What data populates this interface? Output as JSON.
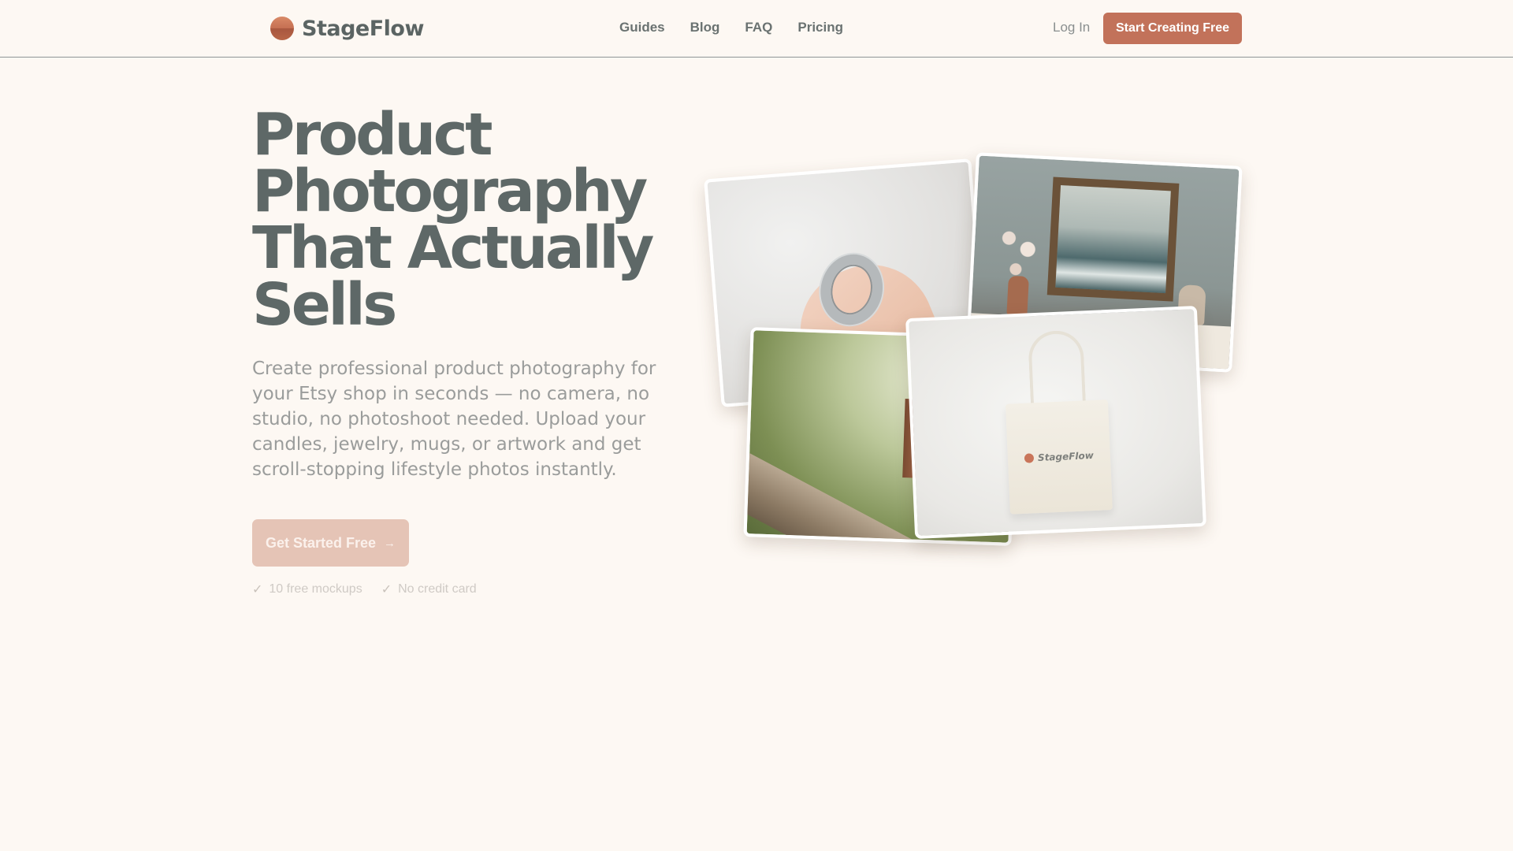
{
  "header": {
    "brand": "StageFlow",
    "nav": [
      "Guides",
      "Blog",
      "FAQ",
      "Pricing"
    ],
    "login_label": "Log In",
    "cta_label": "Start Creating Free"
  },
  "hero": {
    "title_lines": [
      "Product",
      "Photography",
      "That Actually",
      "Sells"
    ],
    "subtitle": "Create professional product photography for your Etsy shop in seconds — no camera, no studio, no photoshoot needed. Upload your candles, jewelry, mugs, or artwork and get scroll-stopping lifestyle photos instantly.",
    "cta_label": "Get Started Free",
    "cta_icon": "arrow-right-icon",
    "perks": [
      "10 free mockups",
      "No credit card"
    ]
  },
  "collage": {
    "tote_logo_text": "StageFlow",
    "photos": [
      "ring-photo",
      "seascape-painting-photo",
      "candle-field-photo",
      "tote-bag-photo"
    ]
  },
  "colors": {
    "brand": "#c2725a",
    "cta_muted": "#e5c4b6",
    "background": "#fdf8f3",
    "heading": "#5e6867"
  }
}
